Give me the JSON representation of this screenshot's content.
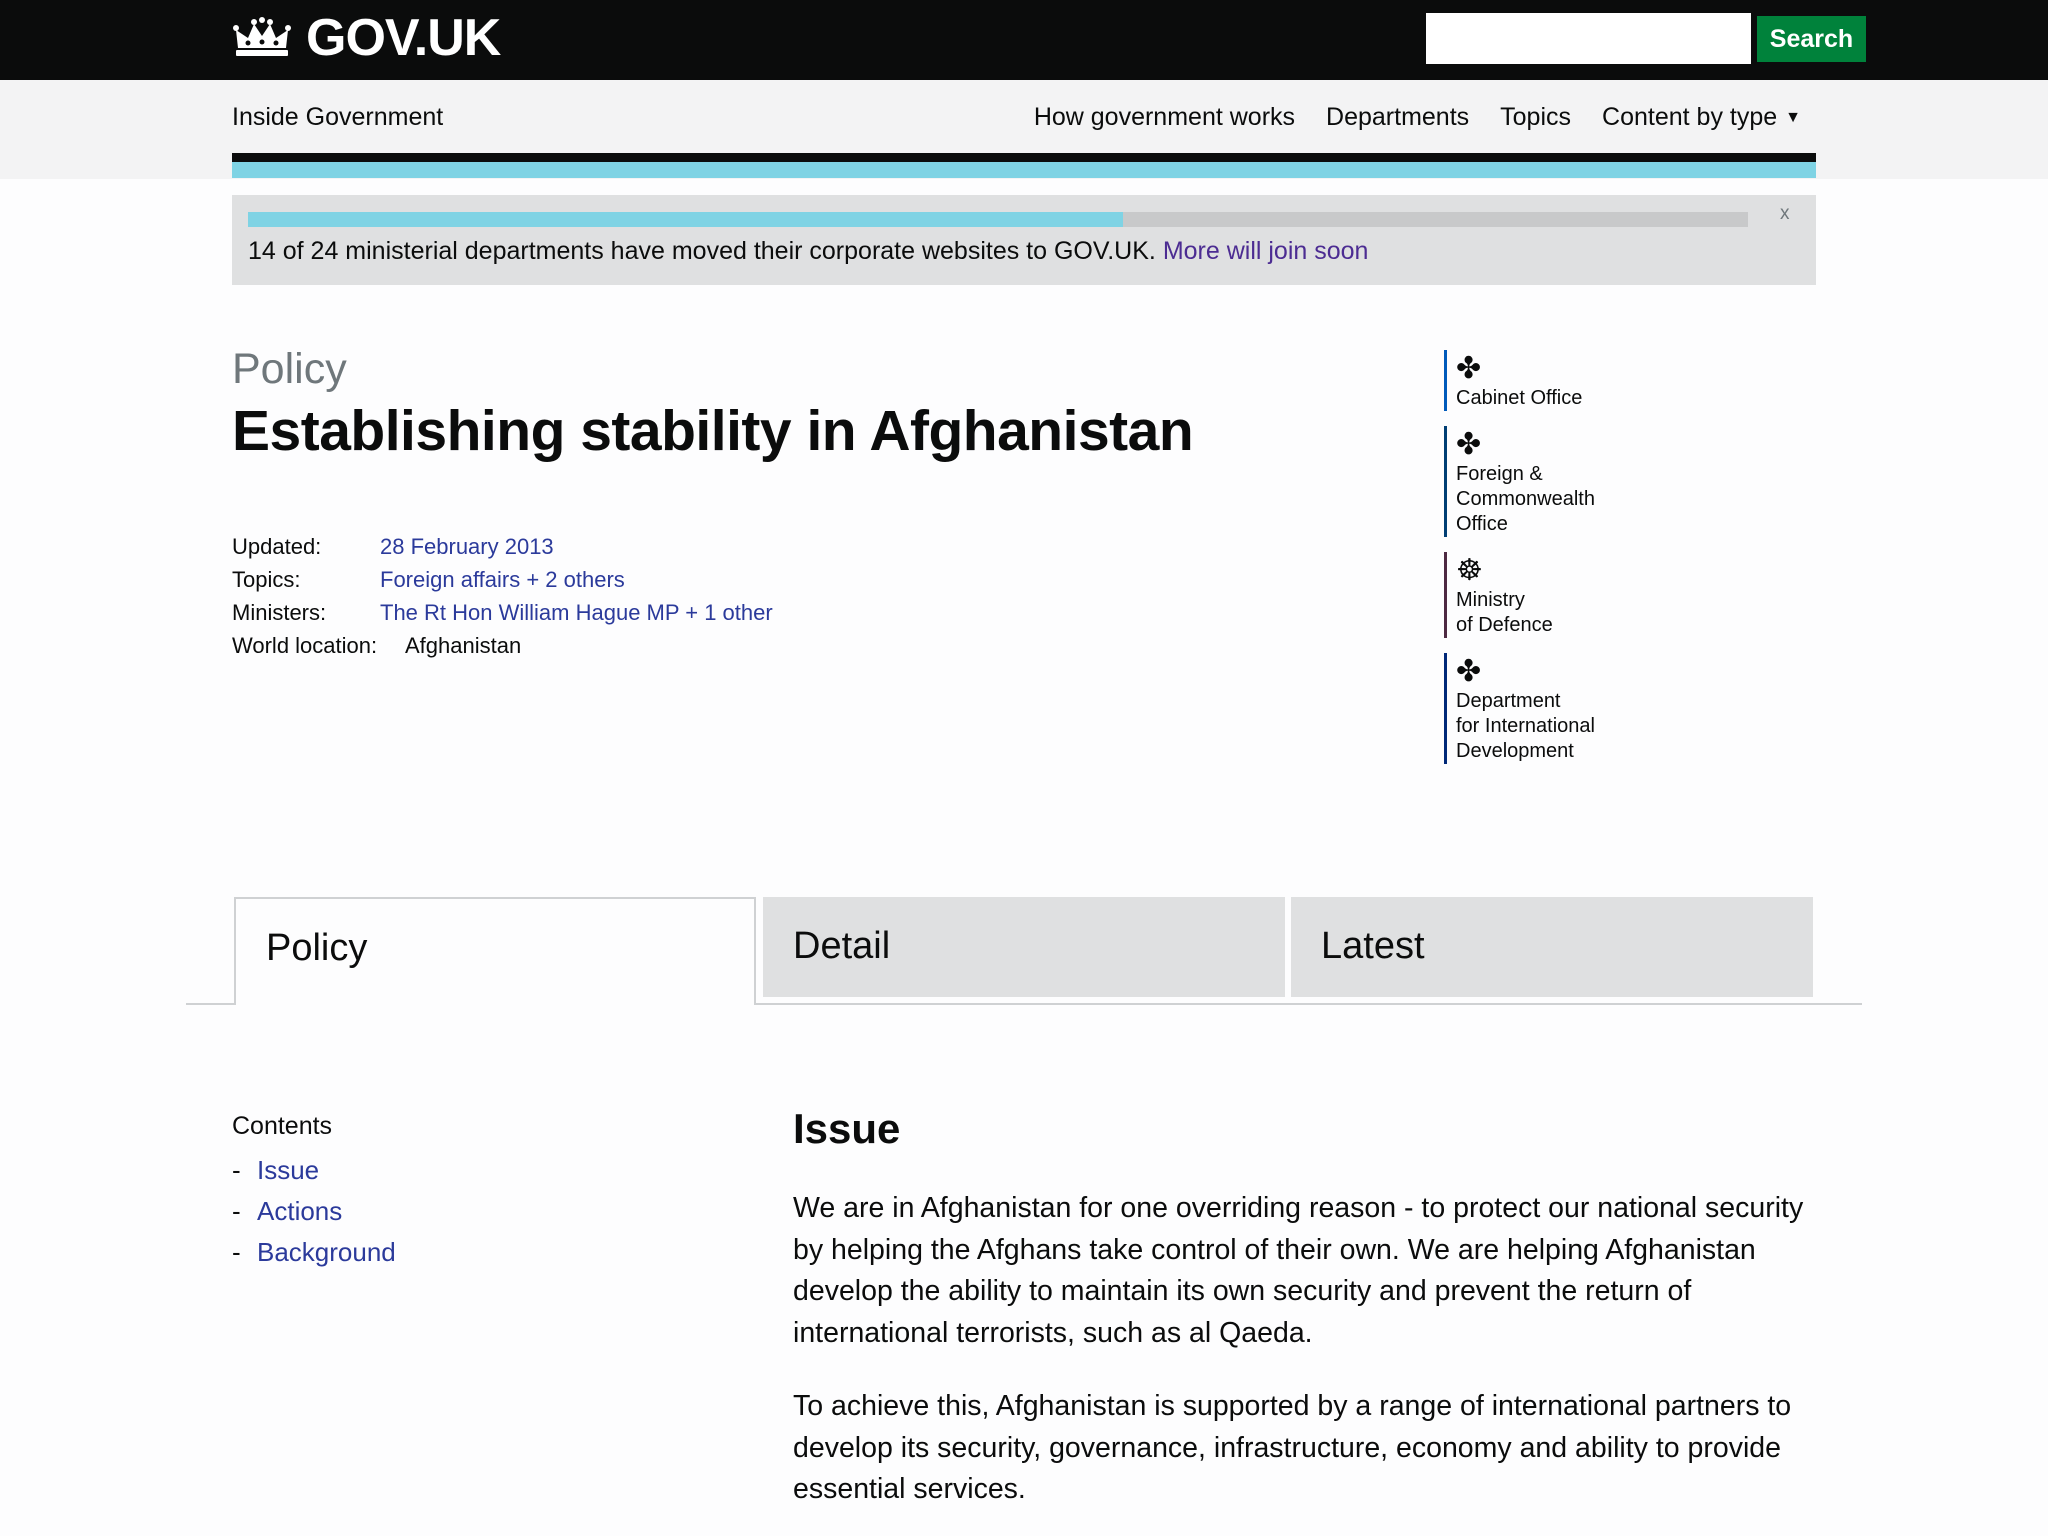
{
  "header": {
    "logo_text": "GOV.UK",
    "logo_icon": "crown-icon",
    "search_placeholder": "",
    "search_button": "Search"
  },
  "subnav": {
    "section": "Inside Government",
    "links": [
      "How government works",
      "Departments",
      "Topics",
      "Content by type"
    ]
  },
  "banner": {
    "progress_fraction": 0.5833,
    "text": "14 of 24 ministerial departments have moved their corporate websites to GOV.UK. ",
    "link": "More will join soon",
    "close": "x"
  },
  "page": {
    "kicker": "Policy",
    "title": "Establishing stability in Afghanistan"
  },
  "meta": {
    "updated_label": "Updated:",
    "updated_value": "28 February 2013",
    "topics_label": "Topics:",
    "topics_value": "Foreign affairs + 2 others",
    "ministers_label": "Ministers:",
    "ministers_value": "The Rt Hon William Hague MP + 1 other",
    "location_label": "World location:",
    "location_value": "Afghanistan"
  },
  "organisations": [
    {
      "name": "Cabinet Office",
      "crest": "royal-arms-icon",
      "color": "#005abb"
    },
    {
      "name": "Foreign &\nCommonwealth\nOffice",
      "crest": "royal-arms-icon",
      "color": "#003e74"
    },
    {
      "name": "Ministry\nof Defence",
      "crest": "mod-crest-icon",
      "color": "#4d2942"
    },
    {
      "name": "Department\nfor International\nDevelopment",
      "crest": "royal-arms-icon",
      "color": "#002878"
    }
  ],
  "tabs": [
    "Policy",
    "Detail",
    "Latest"
  ],
  "contents": {
    "title": "Contents",
    "items": [
      "Issue",
      "Actions",
      "Background"
    ]
  },
  "article": {
    "heading": "Issue",
    "paragraphs": [
      "We are in Afghanistan for one overriding reason - to protect our national security by helping the Afghans take control of their own. We are helping Afghanistan develop the ability to maintain its own security and prevent the return of international terrorists, such as al Qaeda.",
      "To achieve this, Afghanistan is supported by a range of international partners to develop its security, governance, infrastructure, economy and ability to provide essential services."
    ]
  },
  "colors": {
    "header_bg": "#0b0c0c",
    "search_green": "#00823b",
    "accent_blue": "#7fd3e4",
    "link": "#2b3a9b"
  }
}
